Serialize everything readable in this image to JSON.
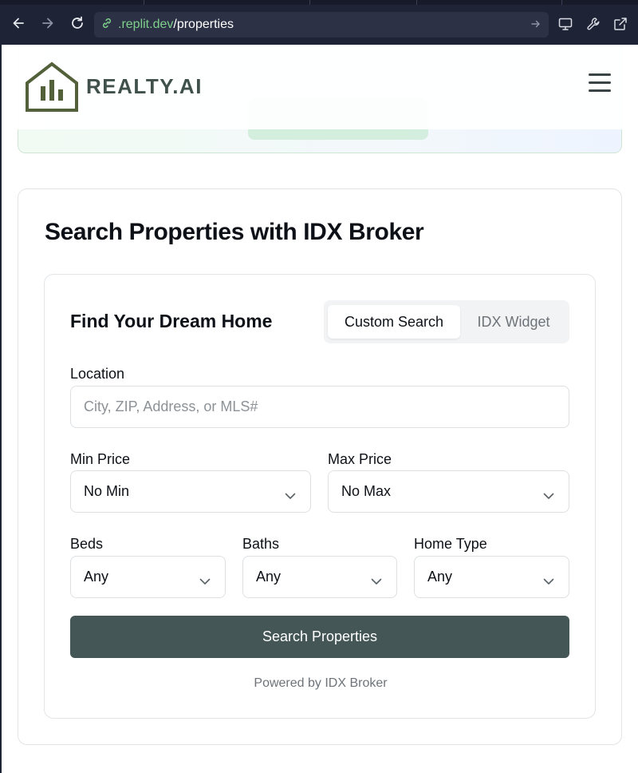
{
  "browser": {
    "url_domain": ".replit.dev",
    "url_path": "/properties"
  },
  "header": {
    "brand": "REALTY.AI"
  },
  "search_section": {
    "title": "Search Properties with IDX Broker",
    "card": {
      "title": "Find Your Dream Home",
      "tabs": [
        {
          "label": "Custom Search",
          "active": true
        },
        {
          "label": "IDX Widget",
          "active": false
        }
      ],
      "location": {
        "label": "Location",
        "placeholder": "City, ZIP, Address, or MLS#"
      },
      "min_price": {
        "label": "Min Price",
        "value": "No Min"
      },
      "max_price": {
        "label": "Max Price",
        "value": "No Max"
      },
      "beds": {
        "label": "Beds",
        "value": "Any"
      },
      "baths": {
        "label": "Baths",
        "value": "Any"
      },
      "home_type": {
        "label": "Home Type",
        "value": "Any"
      },
      "search_button": "Search Properties",
      "powered_by": "Powered by IDX Broker"
    }
  },
  "colors": {
    "brand": "#3f514a",
    "logo": "#52613a",
    "button": "#445655",
    "url_domain": "#7fd08b",
    "chrome_bg": "#1f2336"
  },
  "icons": [
    "back-icon",
    "forward-icon",
    "reload-icon",
    "link-icon",
    "arrow-right-icon",
    "monitor-icon",
    "wrench-icon",
    "external-link-icon",
    "house-logo-icon",
    "hamburger-menu-icon",
    "chevron-down-icon"
  ]
}
